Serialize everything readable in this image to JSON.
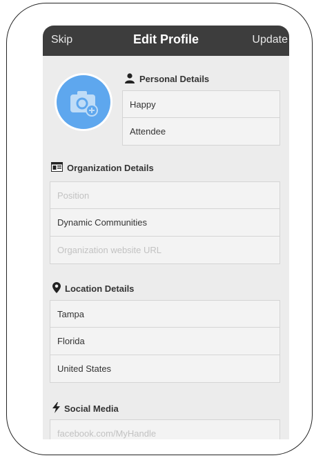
{
  "header": {
    "skip_label": "Skip",
    "title": "Edit Profile",
    "update_label": "Update"
  },
  "personal": {
    "heading": "Personal Details",
    "first_name": "Happy",
    "last_name": "Attendee"
  },
  "organization": {
    "heading": "Organization Details",
    "position_placeholder": "Position",
    "company": "Dynamic Communities",
    "website_placeholder": "Organization website URL"
  },
  "location": {
    "heading": "Location Details",
    "city": "Tampa",
    "state": "Florida",
    "country": "United States"
  },
  "social": {
    "heading": "Social Media",
    "facebook_placeholder": "facebook.com/MyHandle"
  },
  "colors": {
    "navbar": "#3d3d3d",
    "avatar": "#5ea7ee",
    "background": "#ececec"
  }
}
